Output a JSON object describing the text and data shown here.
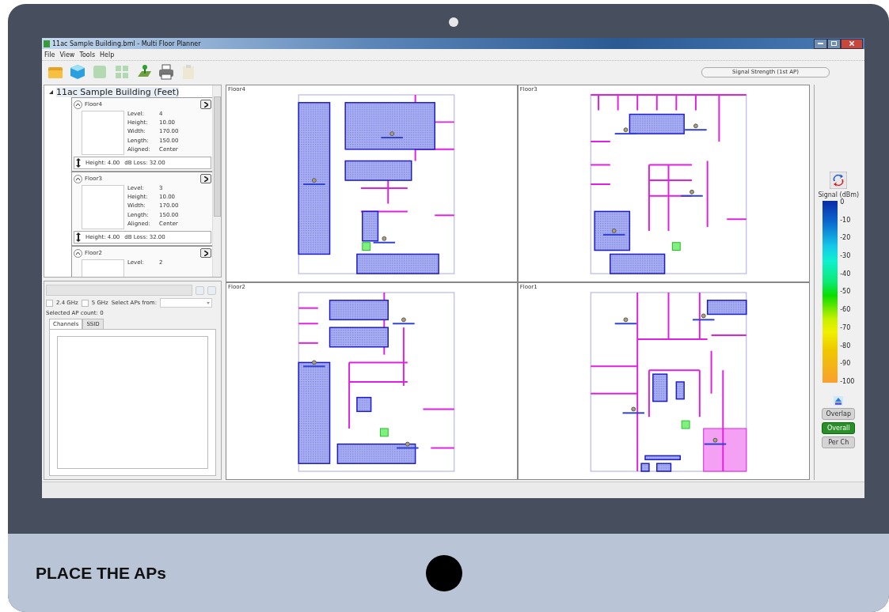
{
  "window": {
    "title": "11ac Sample Building.bml - Multi Floor Planner"
  },
  "menu": [
    "File",
    "View",
    "Tools",
    "Help"
  ],
  "toolbar": [
    {
      "kind": "folder",
      "disabled": false
    },
    {
      "kind": "cube",
      "disabled": false
    },
    {
      "kind": "square",
      "disabled": true
    },
    {
      "kind": "grid",
      "disabled": true
    },
    {
      "kind": "pad",
      "disabled": false
    },
    {
      "kind": "printer",
      "disabled": false
    },
    {
      "kind": "clipboard",
      "disabled": true
    }
  ],
  "view_selector": {
    "value": "Signal Strength (1st AP)"
  },
  "tree": {
    "root": "11ac Sample Building (Feet)",
    "expanded": true,
    "floors": [
      {
        "name": "Floor4",
        "expanded": true,
        "fields": [
          {
            "label": "Level:",
            "value": "4"
          },
          {
            "label": "Height:",
            "value": "10.00"
          },
          {
            "label": "Width:",
            "value": "170.00"
          },
          {
            "label": "Length:",
            "value": "150.00"
          },
          {
            "label": "Aligned:",
            "value": "Center"
          }
        ],
        "height": "Height: 4.00",
        "loss": "dB Loss: 32.00"
      },
      {
        "name": "Floor3",
        "expanded": true,
        "fields": [
          {
            "label": "Level:",
            "value": "3"
          },
          {
            "label": "Height:",
            "value": "10.00"
          },
          {
            "label": "Width:",
            "value": "170.00"
          },
          {
            "label": "Length:",
            "value": "150.00"
          },
          {
            "label": "Aligned:",
            "value": "Center"
          }
        ],
        "height": "Height: 4.00",
        "loss": "dB Loss: 32.00"
      },
      {
        "name": "Floor2",
        "expanded": true,
        "fields": [
          {
            "label": "Level:",
            "value": "2"
          }
        ]
      }
    ]
  },
  "filters": {
    "bands": [
      {
        "label": "2.4 GHz",
        "checked": false
      },
      {
        "label": "5 GHz",
        "checked": false
      }
    ],
    "select_label": "Select APs from:",
    "count": "Selected AP count: 0",
    "tabs": [
      {
        "label": "Channels",
        "selected": true
      },
      {
        "label": "SSID",
        "selected": false
      }
    ]
  },
  "maps": [
    {
      "name": "Floor4"
    },
    {
      "name": "Floor3"
    },
    {
      "name": "Floor2"
    },
    {
      "name": "Floor1"
    }
  ],
  "legend": {
    "title": "Signal (dBm)",
    "ticks": [
      "0",
      "-10",
      "-20",
      "-30",
      "-40",
      "-50",
      "-60",
      "-70",
      "-80",
      "-90",
      "-100"
    ]
  },
  "modes": [
    {
      "label": "Overlap",
      "selected": false
    },
    {
      "label": "Overall",
      "selected": true
    },
    {
      "label": "Per Ch",
      "selected": false
    }
  ],
  "caption": "PLACE THE APs"
}
